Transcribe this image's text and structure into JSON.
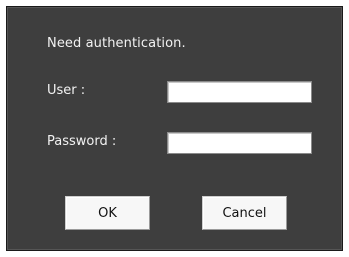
{
  "dialog": {
    "message": "Need authentication.",
    "user_label": "User :",
    "user_value": "",
    "password_label": "Password :",
    "password_value": "",
    "ok_label": "OK",
    "cancel_label": "Cancel"
  }
}
